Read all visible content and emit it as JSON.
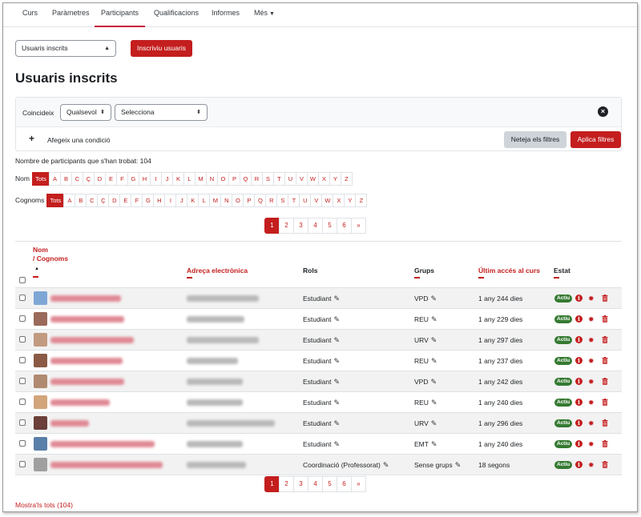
{
  "nav": {
    "tabs": [
      "Curs",
      "Paràmetres",
      "Participants",
      "Qualificacions",
      "Informes",
      "Més"
    ],
    "active": "Participants"
  },
  "enrol_select": {
    "value": "Usuaris inscrits"
  },
  "enrol_button": "Inscriviu usuaris",
  "page_title": "Usuaris inscrits",
  "filter": {
    "match_label": "Coincideix",
    "match_value": "Qualsevol",
    "type_value": "Selecciona",
    "add_condition": "Afegeix una condició",
    "clear_button": "Neteja els filtres",
    "apply_button": "Aplica filtres"
  },
  "participants_count": "Nombre de participants que s'han trobat: 104",
  "initials": {
    "first_label": "Nom",
    "last_label": "Cognoms",
    "all_label": "Tots",
    "letters": [
      "A",
      "B",
      "C",
      "Ç",
      "D",
      "E",
      "F",
      "G",
      "H",
      "I",
      "J",
      "K",
      "L",
      "M",
      "N",
      "O",
      "P",
      "Q",
      "R",
      "S",
      "T",
      "U",
      "V",
      "W",
      "X",
      "Y",
      "Z"
    ]
  },
  "pagination": {
    "pages": [
      "1",
      "2",
      "3",
      "4",
      "5",
      "6"
    ],
    "next": "»",
    "current": "1"
  },
  "table": {
    "headers": {
      "name_first": "Nom",
      "name_sep": "/ Cognoms",
      "sort_arrow": "▲",
      "email": "Adreça electrònica",
      "roles": "Rols",
      "groups": "Grups",
      "last_access": "Últim accés al curs",
      "status": "Estat"
    },
    "rows": [
      {
        "role": "Estudiant",
        "group": "VPD",
        "last_access": "1 any 244 dies",
        "status": "Actiu",
        "avatar": "#7ea7d6"
      },
      {
        "role": "Estudiant",
        "group": "REU",
        "last_access": "1 any 229 dies",
        "status": "Actiu",
        "avatar": "#9a6a5a"
      },
      {
        "role": "Estudiant",
        "group": "URV",
        "last_access": "1 any 297 dies",
        "status": "Actiu",
        "avatar": "#c29a80"
      },
      {
        "role": "Estudiant",
        "group": "REU",
        "last_access": "1 any 237 dies",
        "status": "Actiu",
        "avatar": "#8a5a45"
      },
      {
        "role": "Estudiant",
        "group": "VPD",
        "last_access": "1 any 242 dies",
        "status": "Actiu",
        "avatar": "#b08a70"
      },
      {
        "role": "Estudiant",
        "group": "REU",
        "last_access": "1 any 240 dies",
        "status": "Actiu",
        "avatar": "#d2a57a"
      },
      {
        "role": "Estudiant",
        "group": "URV",
        "last_access": "1 any 296 dies",
        "status": "Actiu",
        "avatar": "#6b3f3a"
      },
      {
        "role": "Estudiant",
        "group": "EMT",
        "last_access": "1 any 240 dies",
        "status": "Actiu",
        "avatar": "#5a7fa8"
      },
      {
        "role": "Coordinació (Professorat)",
        "group": "Sense grups",
        "last_access": "18 segons",
        "status": "Actiu",
        "avatar": "#a0a0a0"
      }
    ]
  },
  "show_all": "Mostra'ls tots (104)",
  "colors": {
    "accent": "#c41e1e",
    "success": "#357a32"
  }
}
